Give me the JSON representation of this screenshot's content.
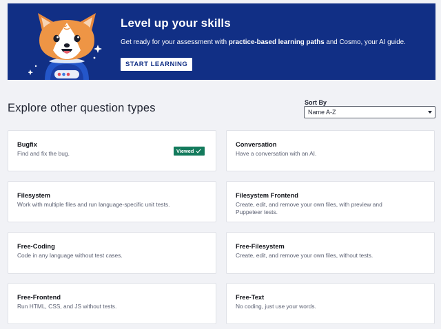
{
  "banner": {
    "title": "Level up your skills",
    "subtitle_prefix": "Get ready for your assessment with ",
    "subtitle_bold": "practice-based learning paths",
    "subtitle_suffix": " and Cosmo, your AI guide.",
    "button_label": "START LEARNING",
    "background_color": "#112f85"
  },
  "section": {
    "title": "Explore other question types"
  },
  "sort": {
    "label": "Sort By",
    "selected": "Name A-Z"
  },
  "cards": [
    {
      "title": "Bugfix",
      "description": "Find and fix the bug.",
      "badge": "Viewed"
    },
    {
      "title": "Conversation",
      "description": "Have a conversation with an AI."
    },
    {
      "title": "Filesystem",
      "description": "Work with multiple files and run language-specific unit tests."
    },
    {
      "title": "Filesystem Frontend",
      "description": "Create, edit, and remove your own files, with preview and Puppeteer tests."
    },
    {
      "title": "Free-Coding",
      "description": "Code in any language without test cases."
    },
    {
      "title": "Free-Filesystem",
      "description": "Create, edit, and remove your own files, without tests."
    },
    {
      "title": "Free-Frontend",
      "description": "Run HTML, CSS, and JS without tests."
    },
    {
      "title": "Free-Text",
      "description": "No coding, just use your words."
    }
  ],
  "colors": {
    "badge_green": "#137a5c",
    "page_background": "#f1f2f6"
  }
}
